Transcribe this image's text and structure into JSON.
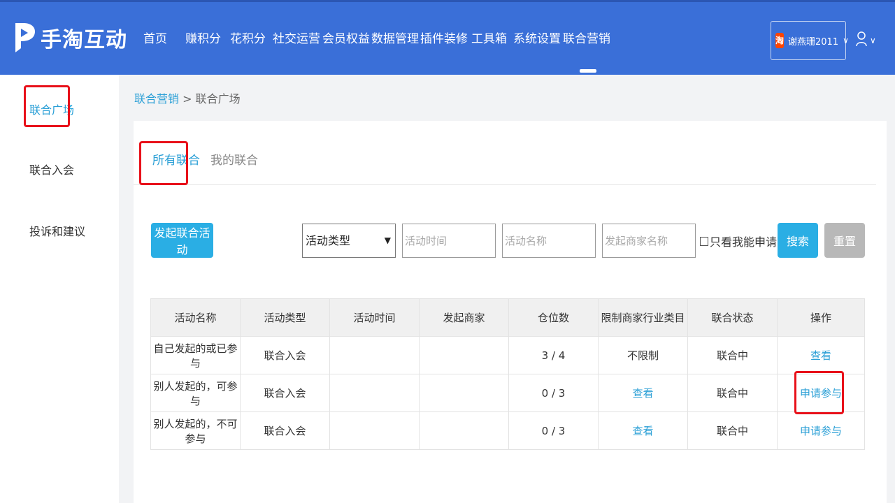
{
  "header": {
    "logo_text": "手淘互动",
    "nav": [
      "首页",
      "赚积分",
      "花积分",
      "社交运营",
      "会员权益",
      "数据管理",
      "插件装修",
      "工具箱",
      "系统设置",
      "联合营销"
    ],
    "active_nav_index": 9,
    "shop": {
      "icon_text": "淘",
      "name": "谢燕珊2011"
    },
    "user_icon": "user-icon"
  },
  "sidebar": {
    "items": [
      "联合广场",
      "联合入会",
      "投诉和建议"
    ],
    "active_index": 0
  },
  "breadcrumb": {
    "parent": "联合营销",
    "separator": " > ",
    "current": "联合广场"
  },
  "tabs": [
    "所有联合",
    "我的联合"
  ],
  "filters": {
    "launch_button": "发起联合活动",
    "type_select": "活动类型",
    "time_placeholder": "活动时间",
    "name_placeholder": "活动名称",
    "merchant_placeholder": "发起商家名称",
    "only_applicable": "只看我能申请的",
    "search_button": "搜索",
    "reset_button": "重置"
  },
  "table": {
    "headers": [
      "活动名称",
      "活动类型",
      "活动时间",
      "发起商家",
      "仓位数",
      "限制商家行业类目",
      "联合状态",
      "操作"
    ],
    "rows": [
      {
        "name": "自己发起的或已参与",
        "type": "联合入会",
        "time": "",
        "merchant": "",
        "slots": "3 / 4",
        "restrict": "不限制",
        "status": "联合中",
        "action": "查看"
      },
      {
        "name": "别人发起的，可参与",
        "type": "联合入会",
        "time": "",
        "merchant": "",
        "slots": "0 / 3",
        "restrict": "查看",
        "status": "联合中",
        "action": "申请参与"
      },
      {
        "name": "别人发起的，不可参与",
        "type": "联合入会",
        "time": "",
        "merchant": "",
        "slots": "0 / 3",
        "restrict": "查看",
        "status": "联合中",
        "action": "申请参与"
      }
    ]
  },
  "colors": {
    "header": "#3a6fd8",
    "accent": "#2aaee4",
    "link": "#2a9fd6",
    "highlight": "#e8111a"
  }
}
